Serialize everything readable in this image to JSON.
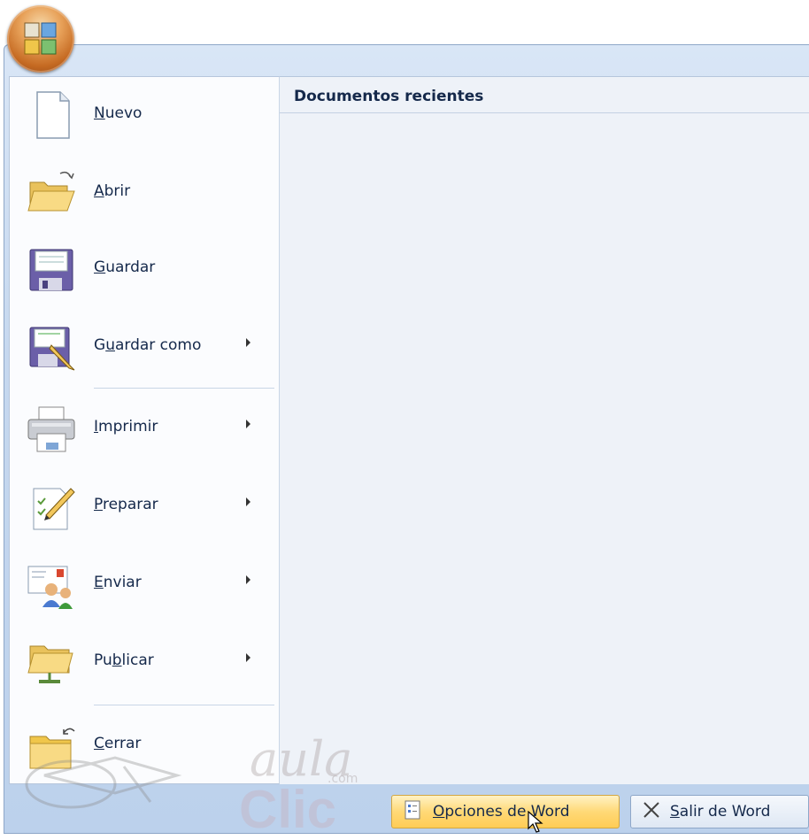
{
  "orb": {
    "icon": "office-button-icon"
  },
  "recent": {
    "title": "Documentos recientes"
  },
  "menu": {
    "items": [
      {
        "pre": "",
        "accel": "N",
        "post": "uevo",
        "icon": "new-document-icon",
        "submenu": false
      },
      {
        "pre": "",
        "accel": "A",
        "post": "brir",
        "icon": "open-folder-icon",
        "submenu": false
      },
      {
        "pre": "",
        "accel": "G",
        "post": "uardar",
        "icon": "save-icon",
        "submenu": false
      },
      {
        "pre": "G",
        "accel": "u",
        "post": "ardar como",
        "icon": "save-as-icon",
        "submenu": true
      },
      {
        "pre": "",
        "accel": "I",
        "post": "mprimir",
        "icon": "printer-icon",
        "submenu": true
      },
      {
        "pre": "",
        "accel": "P",
        "post": "reparar",
        "icon": "prepare-icon",
        "submenu": true
      },
      {
        "pre": "",
        "accel": "E",
        "post": "nviar",
        "icon": "send-icon",
        "submenu": true
      },
      {
        "pre": "Pu",
        "accel": "b",
        "post": "licar",
        "icon": "publish-icon",
        "submenu": true
      },
      {
        "pre": "",
        "accel": "C",
        "post": "errar",
        "icon": "close-folder-icon",
        "submenu": false
      }
    ]
  },
  "buttons": {
    "options": {
      "accel": "O",
      "rest": "pciones de Word",
      "icon": "options-icon"
    },
    "exit": {
      "accel": "S",
      "rest": "alir de Word",
      "icon": "close-x-icon"
    }
  },
  "watermark": {
    "line1": "aula",
    "line2": "Clic",
    "sub": ".com"
  }
}
